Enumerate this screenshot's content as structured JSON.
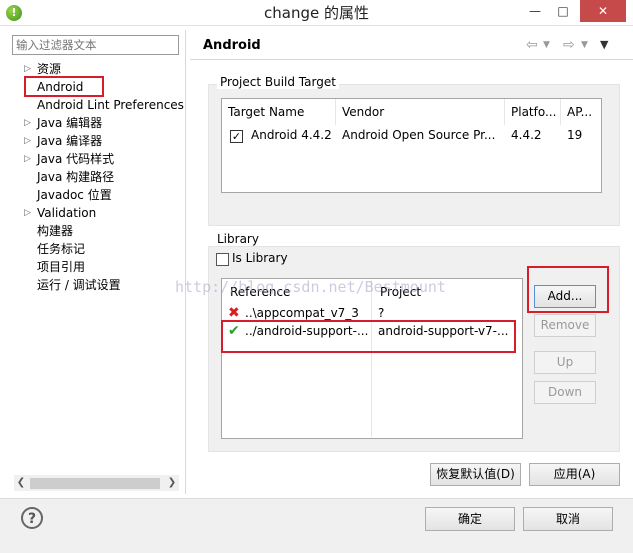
{
  "window": {
    "title": "change 的属性"
  },
  "sidebar": {
    "filter_placeholder": "输入过滤器文本",
    "items": [
      {
        "label": "资源",
        "expandable": true
      },
      {
        "label": "Android",
        "expandable": false
      },
      {
        "label": "Android Lint Preferences",
        "expandable": false
      },
      {
        "label": "Java 编辑器",
        "expandable": true
      },
      {
        "label": "Java 编译器",
        "expandable": true
      },
      {
        "label": "Java 代码样式",
        "expandable": true
      },
      {
        "label": "Java 构建路径",
        "expandable": false
      },
      {
        "label": "Javadoc 位置",
        "expandable": false
      },
      {
        "label": "Validation",
        "expandable": true
      },
      {
        "label": "构建器",
        "expandable": false
      },
      {
        "label": "任务标记",
        "expandable": false
      },
      {
        "label": "项目引用",
        "expandable": false
      },
      {
        "label": "运行 / 调试设置",
        "expandable": false
      }
    ]
  },
  "header": {
    "title": "Android"
  },
  "build_target": {
    "group_label": "Project Build Target",
    "columns": [
      "Target Name",
      "Vendor",
      "Platfo...",
      "AP..."
    ],
    "rows": [
      {
        "checked": true,
        "target": "Android 4.4.2",
        "vendor": "Android Open Source Pr...",
        "platform": "4.4.2",
        "api": "19"
      }
    ]
  },
  "library": {
    "group_label": "Library",
    "is_library_label": "Is Library",
    "columns": [
      "Reference",
      "Project"
    ],
    "rows": [
      {
        "status": "error",
        "reference": "..\\appcompat_v7_3",
        "project": "?"
      },
      {
        "status": "ok",
        "reference": "../android-support-...",
        "project": "android-support-v7-..."
      }
    ],
    "buttons": {
      "add": "Add...",
      "remove": "Remove",
      "up": "Up",
      "down": "Down"
    }
  },
  "actions": {
    "restore_defaults": "恢复默认值(D)",
    "apply": "应用(A)"
  },
  "footer": {
    "ok": "确定",
    "cancel": "取消"
  },
  "watermark": "http://blog.csdn.net/Bestmount",
  "colors": {
    "highlight": "#d61e2a",
    "error": "#d81f1f",
    "ok": "#2a9d2a"
  }
}
